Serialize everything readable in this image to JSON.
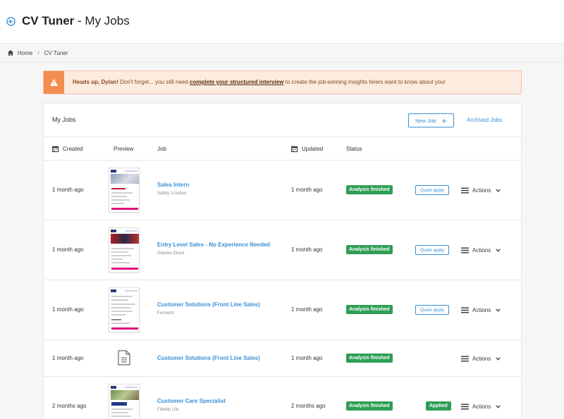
{
  "header": {
    "title_app": "CV Tuner",
    "title_sep": " - ",
    "title_page": "My Jobs"
  },
  "breadcrumb": {
    "home": "Home",
    "sep": "/",
    "current": "CV Tuner"
  },
  "alert": {
    "greeting": "Heads up, Dylan!",
    "text_before": " Don't forget... you still need ",
    "link": "complete your structured interview",
    "text_after": " to create the job-winning insights hirers want to know about you!"
  },
  "card": {
    "title": "My Jobs",
    "new_job_label": "New Job",
    "archived_label": "Archived Jobs"
  },
  "columns": {
    "created": "Created",
    "preview": "Preview",
    "job": "Job",
    "updated": "Updated",
    "status": "Status"
  },
  "rows": [
    {
      "created": "1 month ago",
      "title": "Sales Intern",
      "company": "Safety 'n Action",
      "updated": "1 month ago",
      "status": "Analysis finished",
      "quick_apply": "Quick apply",
      "actions": "Actions"
    },
    {
      "created": "1 month ago",
      "title": "Entry Level Sales - No Experience Needed",
      "company": "Impulse Direct",
      "updated": "1 month ago",
      "status": "Analysis finished",
      "quick_apply": "Quick apply",
      "actions": "Actions"
    },
    {
      "created": "1 month ago",
      "title": "Customer Solutions (Front Line Sales)",
      "company": "Ferntech",
      "updated": "1 month ago",
      "status": "Analysis finished",
      "quick_apply": "Quick apply",
      "actions": "Actions"
    },
    {
      "created": "1 month ago",
      "title": "Customer Solutions (Front Line Sales)",
      "company": "",
      "updated": "1 month ago",
      "status": "Analysis finished",
      "actions": "Actions"
    },
    {
      "created": "2 months ago",
      "title": "Customer Care Specialist",
      "company": "Fidelity Life",
      "updated": "2 months ago",
      "status": "Analysis finished",
      "applied": "Applied",
      "actions": "Actions"
    }
  ],
  "colors": {
    "accent": "#3a8fd6",
    "success": "#2e9e55",
    "alert_bg": "#fcebdf",
    "alert_icon": "#f28c4f",
    "thumb_button": "#e0137f"
  }
}
